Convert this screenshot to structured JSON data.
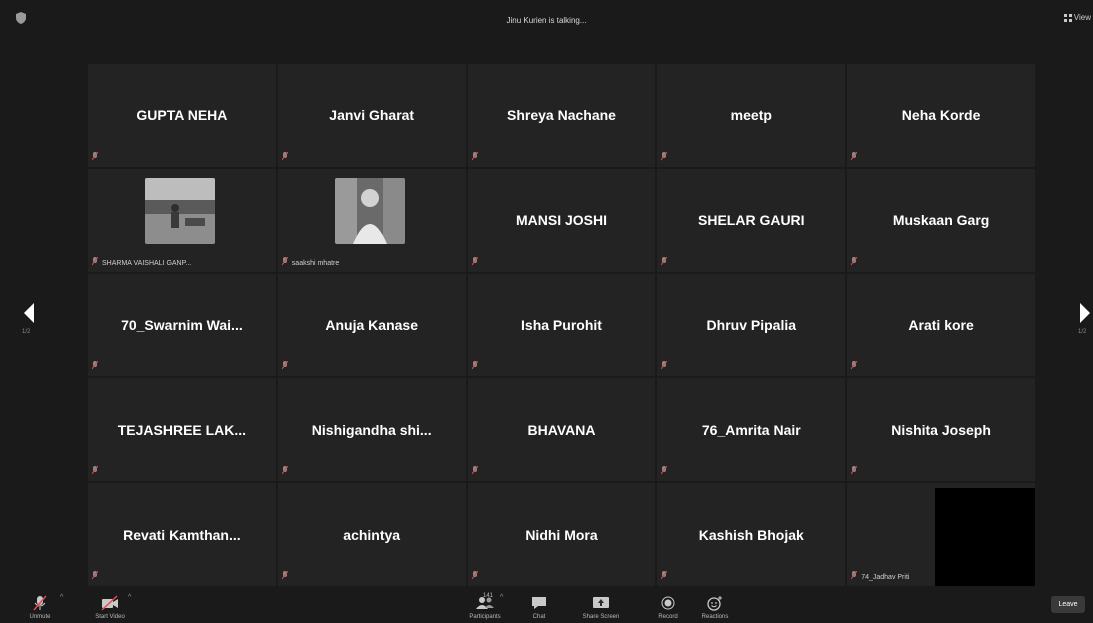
{
  "topbar": {
    "talking": "Jinu Kurien is talking...",
    "view_label": "View"
  },
  "nav": {
    "prev_label": "1/2",
    "next_label": "1/2"
  },
  "tiles": [
    {
      "name": "GUPTA NEHA"
    },
    {
      "name": "Janvi Gharat"
    },
    {
      "name": "Shreya Nachane"
    },
    {
      "name": "meetp"
    },
    {
      "name": "Neha Korde"
    },
    {
      "name": "",
      "video_label": "SHARMA VAISHALI GANP..."
    },
    {
      "name": "",
      "video_label": "saakshi mhatre"
    },
    {
      "name": "MANSI JOSHI"
    },
    {
      "name": "SHELAR GAURI"
    },
    {
      "name": "Muskaan Garg"
    },
    {
      "name": "70_Swarnim Wai..."
    },
    {
      "name": "Anuja Kanase"
    },
    {
      "name": "Isha Purohit"
    },
    {
      "name": "Dhruv Pipalia"
    },
    {
      "name": "Arati kore"
    },
    {
      "name": "TEJASHREE LAK..."
    },
    {
      "name": "Nishigandha shi..."
    },
    {
      "name": "BHAVANA"
    },
    {
      "name": "76_Amrita Nair"
    },
    {
      "name": "Nishita Joseph"
    },
    {
      "name": "Revati Kamthan..."
    },
    {
      "name": "achintya"
    },
    {
      "name": "Nidhi Mora"
    },
    {
      "name": "Kashish Bhojak"
    },
    {
      "name": "",
      "video_label": "74_Jadhav Priti"
    }
  ],
  "toolbar": {
    "unmute_label": "Unmute",
    "start_video_label": "Start Video",
    "participants_label": "Participants",
    "participants_count": "141",
    "chat_label": "Chat",
    "share_screen_label": "Share Screen",
    "record_label": "Record",
    "reactions_label": "Reactions",
    "leave_label": "Leave"
  },
  "colors": {
    "background": "#1a1a1a",
    "tile": "#232323",
    "muted_red": "#e04a4a"
  }
}
